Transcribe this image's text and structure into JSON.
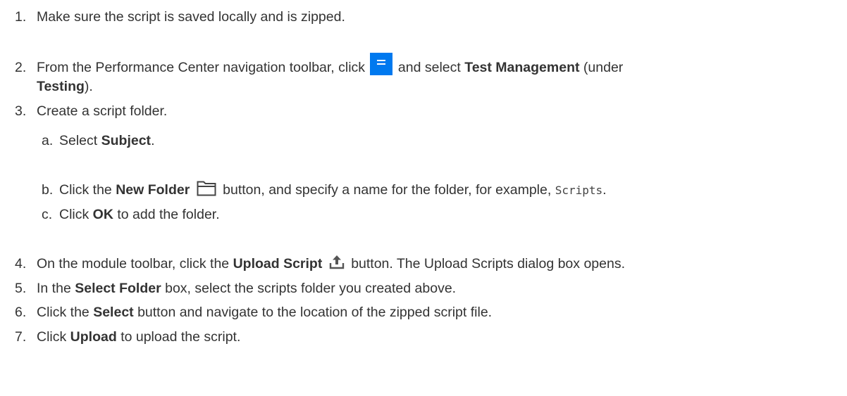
{
  "steps": [
    {
      "number": "1.",
      "text": "Make sure the script is saved locally and is zipped."
    },
    {
      "number": "2.",
      "pre": "From the Performance Center navigation toolbar, click",
      "mid": "and select",
      "bold1": "Test Management",
      "post1": "(under",
      "bold2": "Testing",
      "post2": ")."
    },
    {
      "number": "3.",
      "text": "Create a script folder."
    },
    {
      "number": "4.",
      "pre": "On the module toolbar, click the",
      "bold": "Upload Script",
      "post": "button. The Upload Scripts dialog box opens."
    },
    {
      "number": "5.",
      "pre": "In the",
      "bold": "Select Folder",
      "post": "box, select the scripts folder you created above."
    },
    {
      "number": "6.",
      "pre": "Click the",
      "bold": "Select",
      "post": "button and navigate to the location of the zipped script file."
    },
    {
      "number": "7.",
      "pre": "Click",
      "bold": "Upload",
      "post": "to upload the script."
    }
  ],
  "substeps": [
    {
      "letter": "a.",
      "pre": "Select",
      "bold": "Subject",
      "post": "."
    },
    {
      "letter": "b.",
      "pre": "Click the",
      "bold": "New Folder",
      "post": "button, and specify a name for the folder, for example,",
      "code": "Scripts",
      "post2": "."
    },
    {
      "letter": "c.",
      "pre": "Click",
      "bold": "OK",
      "post": "to add the folder."
    }
  ],
  "icons": {
    "menu": "menu-icon",
    "folder": "folder-icon",
    "upload": "upload-icon",
    "accent_color": "#0079ef"
  }
}
